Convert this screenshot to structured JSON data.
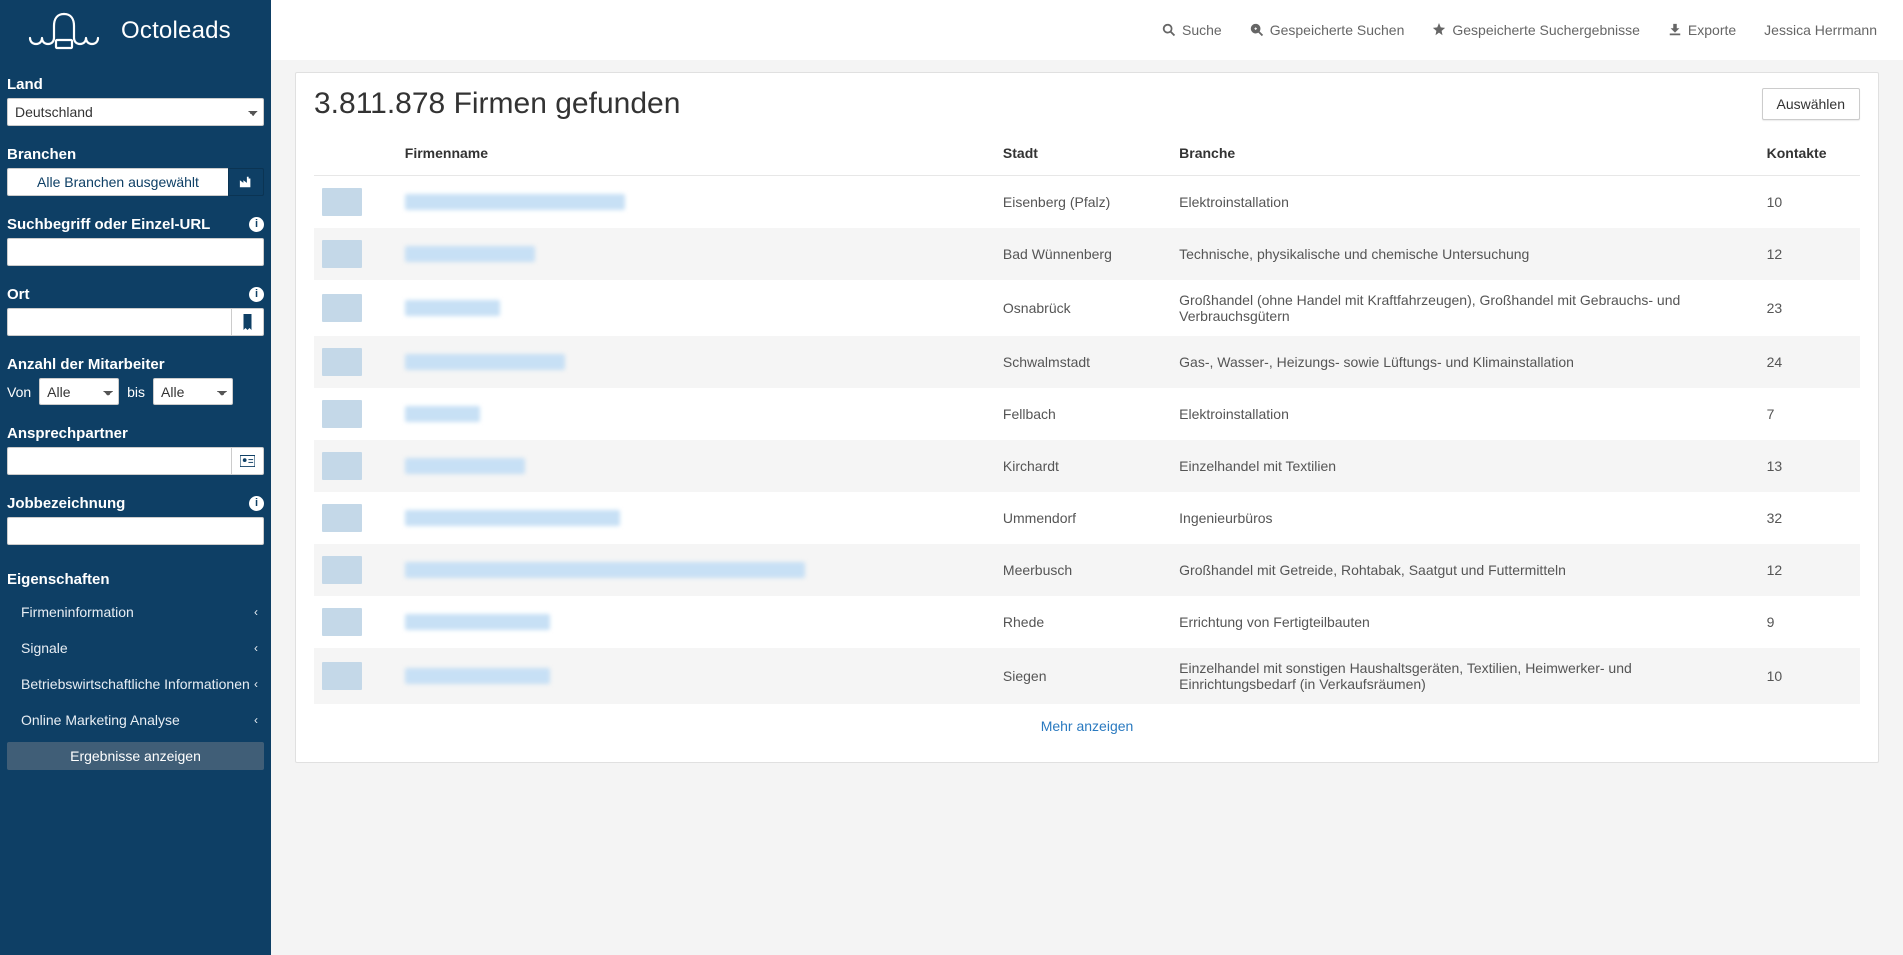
{
  "brand": "Octoleads",
  "topbar": {
    "search": "Suche",
    "savedSearches": "Gespeicherte Suchen",
    "savedResults": "Gespeicherte Suchergebnisse",
    "exports": "Exporte",
    "user": "Jessica Herrmann"
  },
  "sidebar": {
    "landLabel": "Land",
    "landValue": "Deutschland",
    "branchenLabel": "Branchen",
    "branchenBtn": "Alle Branchen ausgewählt",
    "suchLabel": "Suchbegriff oder Einzel-URL",
    "ortLabel": "Ort",
    "mitLabel": "Anzahl der Mitarbeiter",
    "vonLabel": "Von",
    "bisLabel": "bis",
    "alle": "Alle",
    "anspLabel": "Ansprechpartner",
    "jobLabel": "Jobbezeichnung",
    "eigLabel": "Eigenschaften",
    "acc": [
      "Firmeninformation",
      "Signale",
      "Betriebswirtschaftliche Informationen",
      "Online Marketing Analyse"
    ],
    "submit": "Ergebnisse anzeigen"
  },
  "results": {
    "title": "3.811.878 Firmen gefunden",
    "selectBtn": "Auswählen",
    "headers": {
      "name": "Firmenname",
      "stadt": "Stadt",
      "branche": "Branche",
      "kontakte": "Kontakte"
    },
    "rows": [
      {
        "nameW": 220,
        "stadt": "Eisenberg (Pfalz)",
        "branche": "Elektroinstallation",
        "kontakte": "10"
      },
      {
        "nameW": 130,
        "stadt": "Bad Wünnenberg",
        "branche": "Technische, physikalische und chemische Untersuchung",
        "kontakte": "12"
      },
      {
        "nameW": 95,
        "stadt": "Osnabrück",
        "branche": "Großhandel (ohne Handel mit Kraftfahrzeugen), Großhandel mit Gebrauchs- und Verbrauchsgütern",
        "kontakte": "23"
      },
      {
        "nameW": 160,
        "stadt": "Schwalmstadt",
        "branche": "Gas-, Wasser-, Heizungs- sowie Lüftungs- und Klimainstallation",
        "kontakte": "24"
      },
      {
        "nameW": 75,
        "stadt": "Fellbach",
        "branche": "Elektroinstallation",
        "kontakte": "7"
      },
      {
        "nameW": 120,
        "stadt": "Kirchardt",
        "branche": "Einzelhandel mit Textilien",
        "kontakte": "13"
      },
      {
        "nameW": 215,
        "stadt": "Ummendorf",
        "branche": "Ingenieurbüros",
        "kontakte": "32"
      },
      {
        "nameW": 400,
        "stadt": "Meerbusch",
        "branche": "Großhandel mit Getreide, Rohtabak, Saatgut und Futtermitteln",
        "kontakte": "12"
      },
      {
        "nameW": 145,
        "stadt": "Rhede",
        "branche": "Errichtung von Fertigteilbauten",
        "kontakte": "9"
      },
      {
        "nameW": 145,
        "stadt": "Siegen",
        "branche": "Einzelhandel mit sonstigen Haushaltsgeräten, Textilien, Heimwerker- und Einrichtungsbedarf (in Verkaufsräumen)",
        "kontakte": "10"
      }
    ],
    "more": "Mehr anzeigen"
  }
}
